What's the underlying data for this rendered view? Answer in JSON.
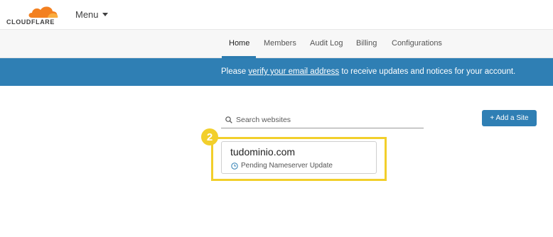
{
  "header": {
    "brand": "CLOUDFLARE",
    "menu_label": "Menu",
    "logo_color": "#f38020"
  },
  "nav": {
    "tabs": [
      {
        "label": "Home",
        "active": true
      },
      {
        "label": "Members",
        "active": false
      },
      {
        "label": "Audit Log",
        "active": false
      },
      {
        "label": "Billing",
        "active": false
      },
      {
        "label": "Configurations",
        "active": false
      }
    ],
    "accent": "#2c7cb0"
  },
  "notice": {
    "prefix": "Please ",
    "link": "verify your email address",
    "suffix": " to receive updates and notices for your account.",
    "background": "#2f7fb4"
  },
  "search": {
    "placeholder": "Search websites",
    "value": ""
  },
  "add_site": {
    "label": "+ Add a Site"
  },
  "step": {
    "number": "2",
    "color": "#f2cf2b"
  },
  "sites": [
    {
      "domain": "tudominio.com",
      "status": "Pending Nameserver Update",
      "status_icon": "clock-icon"
    }
  ]
}
